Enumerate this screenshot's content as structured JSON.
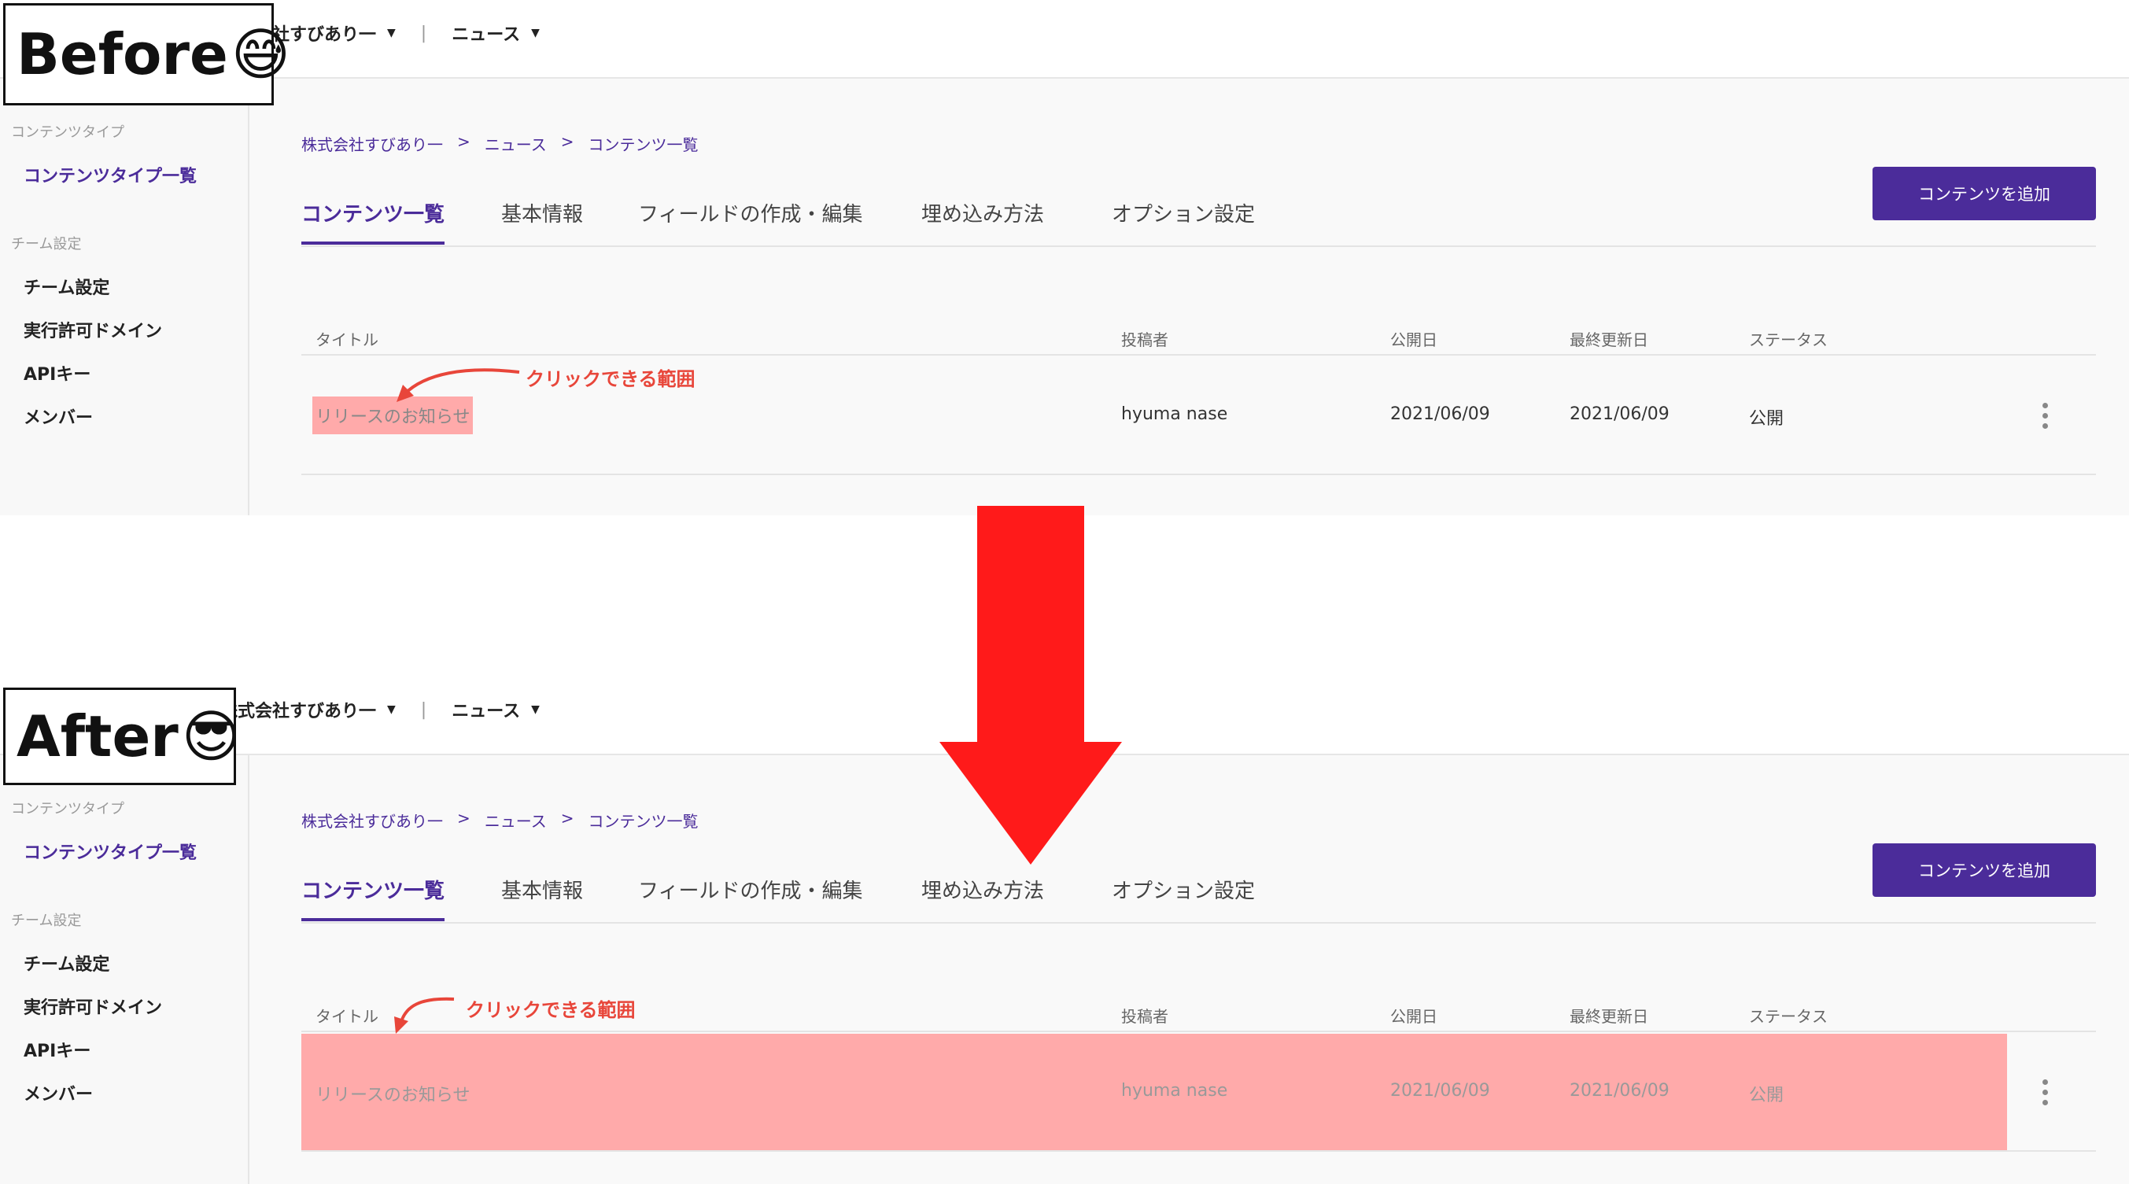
{
  "before": {
    "label": "Before",
    "label_emoji": "😅",
    "topbar": {
      "company": "株式会社すびあり一",
      "service": "ニュース"
    },
    "sidebar": {
      "section_content_type": "コンテンツタイプ",
      "content_type_list": "コンテンツタイプ一覧",
      "section_team": "チーム設定",
      "items": [
        "チーム設定",
        "実行許可ドメイン",
        "APIキー",
        "メンバー"
      ]
    },
    "breadcrumb": [
      "株式会社すびあり一",
      "ニュース",
      "コンテンツ一覧"
    ],
    "tabs": [
      "コンテンツ一覧",
      "基本情報",
      "フィールドの作成・編集",
      "埋め込み方法",
      "オプション設定"
    ],
    "add_button": "コンテンツを追加",
    "columns": [
      "タイトル",
      "投稿者",
      "公開日",
      "最終更新日",
      "ステータス"
    ],
    "row": {
      "title": "リリースのお知らせ",
      "author": "hyuma nase",
      "published": "2021/06/09",
      "updated": "2021/06/09",
      "status": "公開"
    },
    "annotation": "クリックできる範囲"
  },
  "after": {
    "label": "After",
    "label_emoji": "😎",
    "topbar": {
      "company": "株式会社すびあり一",
      "service": "ニュース"
    },
    "sidebar": {
      "section_content_type": "コンテンツタイプ",
      "content_type_list": "コンテンツタイプ一覧",
      "section_team": "チーム設定",
      "items": [
        "チーム設定",
        "実行許可ドメイン",
        "APIキー",
        "メンバー"
      ]
    },
    "breadcrumb": [
      "株式会社すびあり一",
      "ニュース",
      "コンテンツ一覧"
    ],
    "tabs": [
      "コンテンツ一覧",
      "基本情報",
      "フィールドの作成・編集",
      "埋め込み方法",
      "オプション設定"
    ],
    "add_button": "コンテンツを追加",
    "columns": [
      "タイトル",
      "投稿者",
      "公開日",
      "最終更新日",
      "ステータス"
    ],
    "row": {
      "title": "リリースのお知らせ",
      "author": "hyuma nase",
      "published": "2021/06/09",
      "updated": "2021/06/09",
      "status": "公開"
    },
    "annotation": "クリックできる範囲"
  },
  "colors": {
    "accent": "#4b2c9a",
    "highlight": "#ffaaaa",
    "arrow": "#ff1a1a",
    "annotation": "#e8463a"
  }
}
